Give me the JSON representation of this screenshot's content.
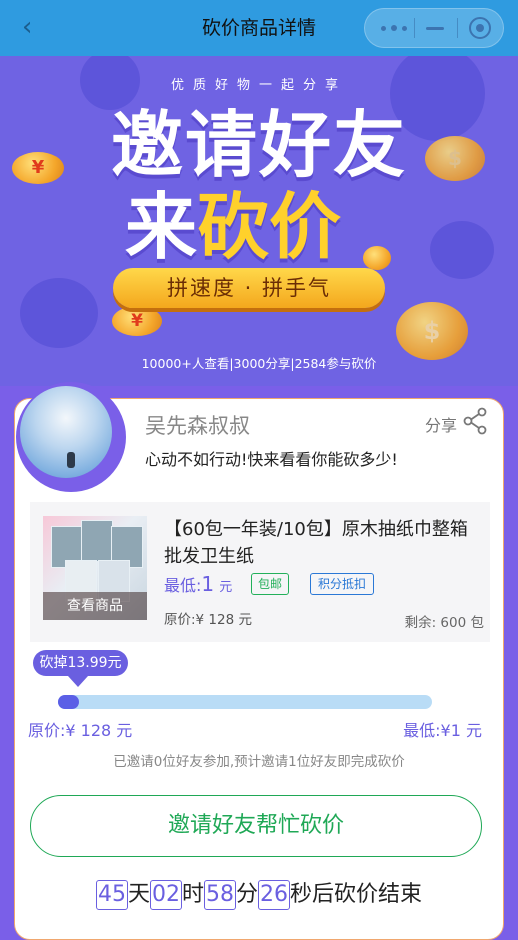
{
  "topbar": {
    "title": "砍价商品详情",
    "back_icon": "‹"
  },
  "banner": {
    "tagline": "优质好物一起分享",
    "headline_line1": "邀请好友",
    "headline_line2_white": "来",
    "headline_line2_yellow": "砍价",
    "pill_text": "拼速度 · 拼手气",
    "stats": "10000+人查看|3000分享|2584参与砍价",
    "coin_symbol": "¥"
  },
  "user": {
    "name": "吴先森叔叔",
    "share_label": "分享",
    "slogan": "心动不如行动!快来看看你能砍多少!"
  },
  "product": {
    "name": "【60包一年装/10包】原木抽纸巾整箱批发卫生纸",
    "view_label": "查看商品",
    "lowest_prefix": "最低:",
    "lowest_value": "1",
    "lowest_unit": "元",
    "tag_free_shipping": "包邮",
    "tag_points": "积分抵扣",
    "original_price": "原价:¥ 128 元",
    "remaining": "剩余: 600 包"
  },
  "progress": {
    "cut_label": "砍掉13.99元",
    "left_label": "原价:¥ 128 元",
    "right_label": "最低:¥1 元",
    "fraction": 0.055,
    "tip": "已邀请0位好友参加,预计邀请1位好友即完成砍价"
  },
  "actions": {
    "invite_button": "邀请好友帮忙砍价"
  },
  "countdown": {
    "days": "45",
    "days_unit": "天",
    "hours": "02",
    "hours_unit": "时",
    "minutes": "58",
    "minutes_unit": "分",
    "seconds": "26",
    "seconds_unit": "秒后砍价结束"
  },
  "colors": {
    "accent": "#6a5fe0",
    "green": "#1fa856",
    "topbar": "#2f9be0",
    "banner": "#6f63e3"
  }
}
